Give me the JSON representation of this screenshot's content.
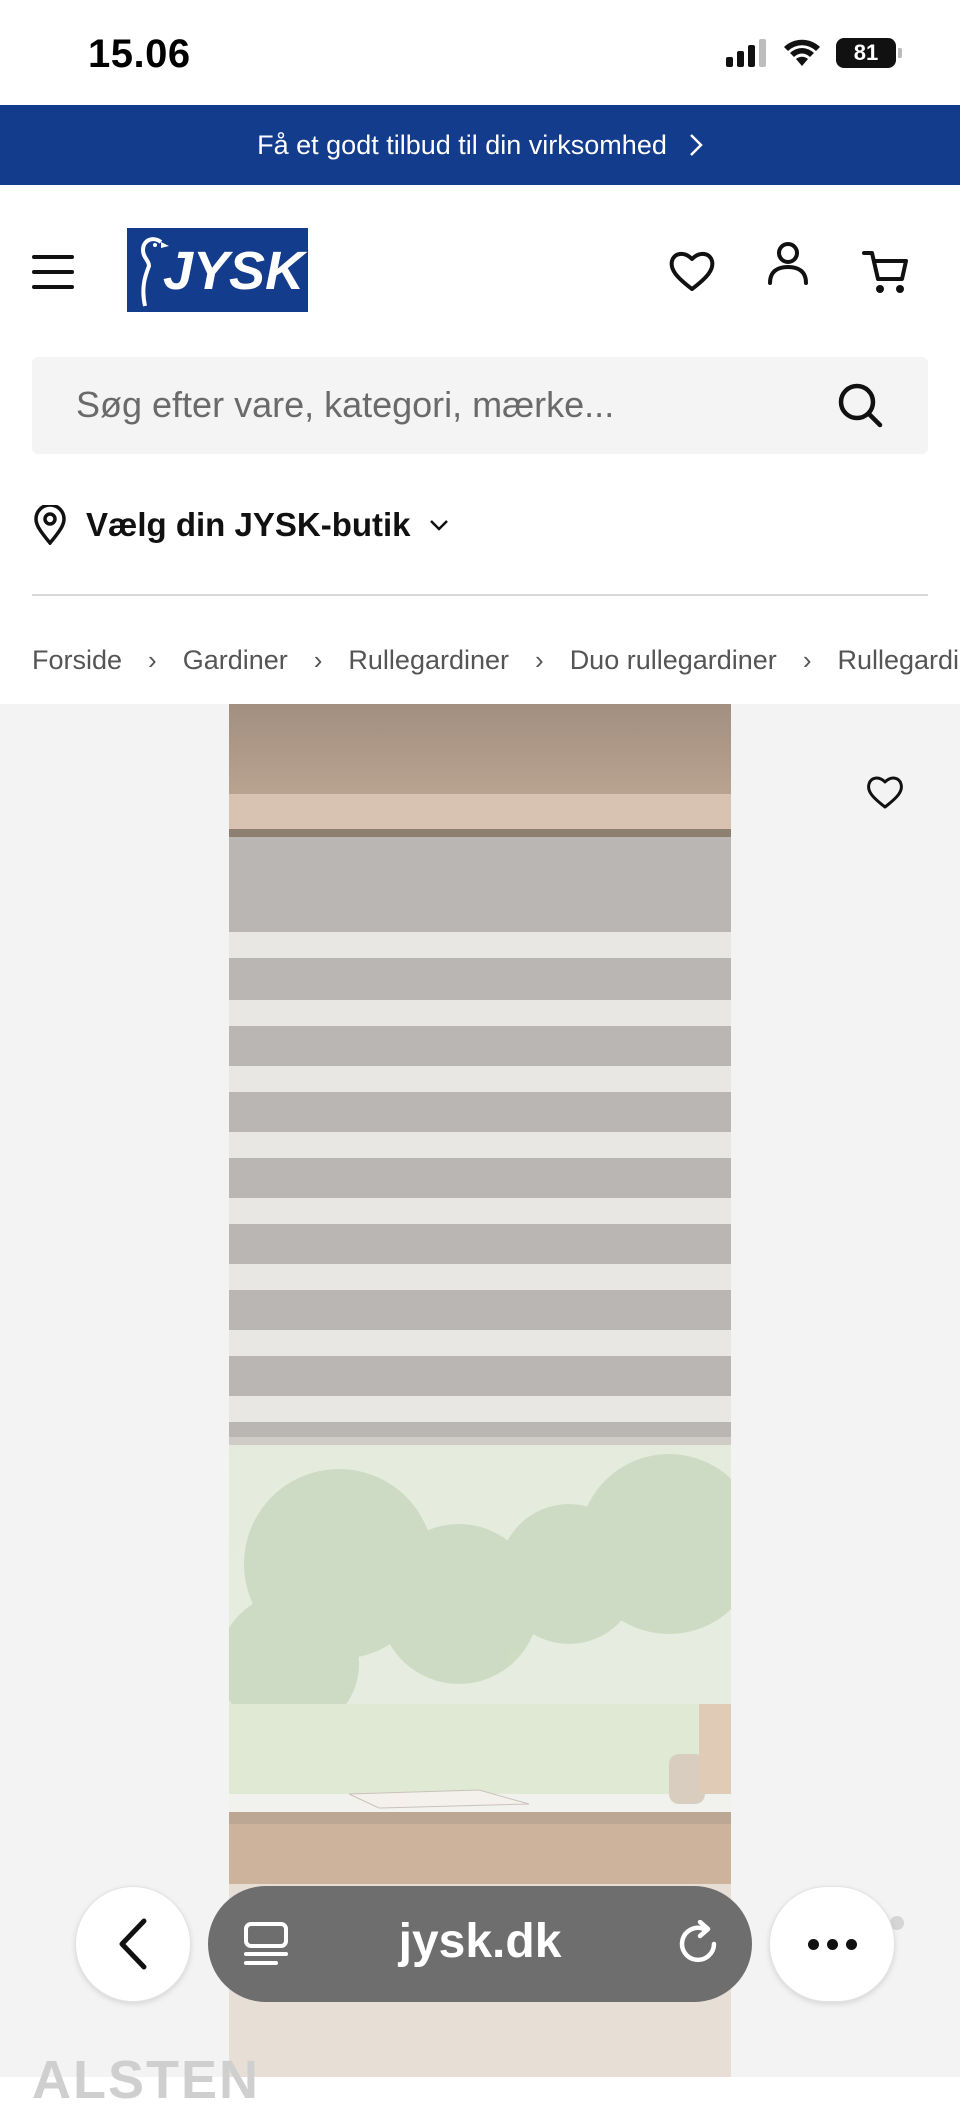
{
  "status_bar": {
    "time": "15.06",
    "battery": "81"
  },
  "promo": {
    "text": "Få et godt tilbud til din virksomhed"
  },
  "header": {
    "logo_text": "JYSK"
  },
  "search": {
    "placeholder": "Søg efter vare, kategori, mærke..."
  },
  "store": {
    "label": "Vælg din JYSK-butik"
  },
  "breadcrumb": [
    "Forside",
    "Gardiner",
    "Rullegardiner",
    "Duo rullegardiner",
    "Rullegardin"
  ],
  "product": {
    "name_partial": "ALSTEN"
  },
  "browser": {
    "url": "jysk.dk"
  },
  "colors": {
    "brand_blue": "#143c8c",
    "background_gray": "#f3f3f3",
    "url_pill": "#6e6e6e"
  }
}
